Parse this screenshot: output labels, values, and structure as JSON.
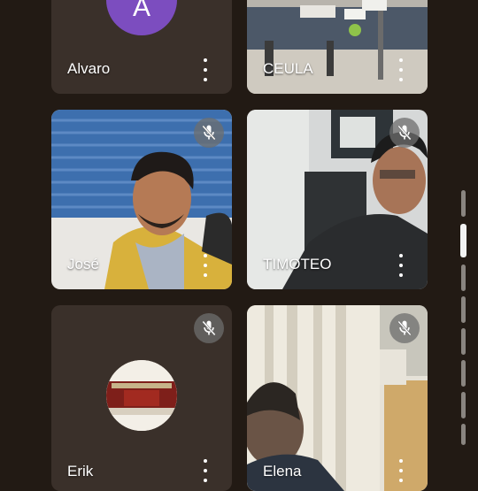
{
  "participants": [
    {
      "name": "Alvaro",
      "avatar_letter": "A",
      "avatar_color": "#7c4dbf",
      "muted": false
    },
    {
      "name": "CEULA",
      "muted": false
    },
    {
      "name": "José",
      "muted": true
    },
    {
      "name": "TIMOTEO",
      "muted": true
    },
    {
      "name": "Erik",
      "muted": true
    },
    {
      "name": "Elena",
      "muted": true
    }
  ],
  "icons": {
    "menu": "more-vert-icon",
    "mic_off": "mic-off-icon"
  },
  "colors": {
    "background": "#221a14",
    "tile": "#3a302a",
    "mute_badge": "#6e6e6e"
  }
}
